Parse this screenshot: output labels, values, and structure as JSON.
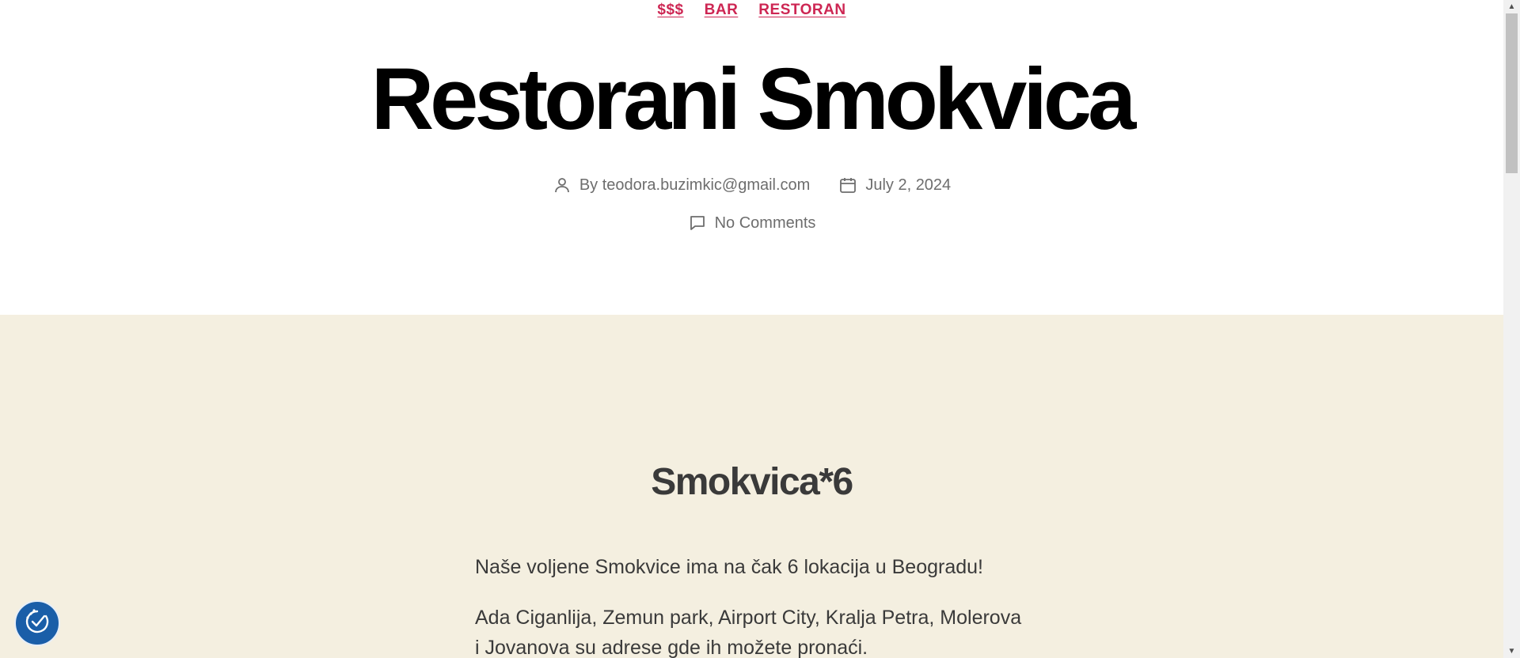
{
  "categories": [
    "$$$",
    "BAR",
    "RESTORAN"
  ],
  "post": {
    "title": "Restorani Smokvica",
    "author_label": "By teodora.buzimkic@gmail.com",
    "date": "July 2, 2024",
    "comments": "No Comments"
  },
  "content": {
    "heading": "Smokvica*6",
    "paragraph1": "Naše voljene Smokvice ima na čak 6 lokacija u Beogradu!",
    "paragraph2": "Ada Ciganlija, Zemun park, Airport City, Kralja Petra, Molerova i Jovanova su adrese gde ih možete pronaći."
  },
  "icons": {
    "author": "person-icon",
    "date": "calendar-icon",
    "comments": "comment-icon",
    "accessibility": "accessibility-icon"
  },
  "colors": {
    "accent": "#cd2653",
    "content_bg": "#f4efe0",
    "accessibility_button": "#1a5ea8"
  }
}
